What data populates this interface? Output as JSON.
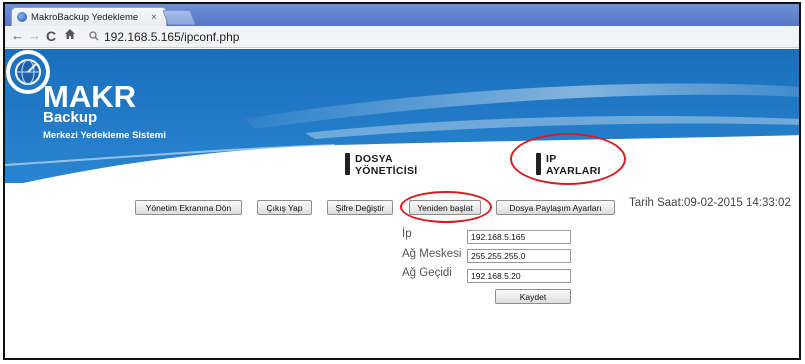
{
  "browser": {
    "tab_title": "MakroBackup Yedekleme",
    "tab_close": "×",
    "url": "192.168.5.165/ipconf.php"
  },
  "header": {
    "logo_main": "MAKR",
    "logo_sub": "Backup",
    "tagline": "Merkezi Yedekleme Sistemi"
  },
  "nav": {
    "file_manager": [
      "DOSYA",
      "YÖNETİCİSİ"
    ],
    "ip_settings": [
      "IP",
      "AYARLARI"
    ]
  },
  "actions": {
    "back_to_admin": "Yönetim Ekranına Dön",
    "logout": "Çıkış Yap",
    "change_password": "Şifre Değiştir",
    "restart": "Yeniden başlat",
    "file_sharing_settings": "Dosya Paylaşım Ayarları"
  },
  "datetime": "Tarih Saat:09-02-2015 14:33:02",
  "form": {
    "ip_label": "İp",
    "ip_value": "192.168.5.165",
    "mask_label": "Ağ Meskesi",
    "mask_value": "255.255.255.0",
    "gateway_label": "Ağ Geçidi",
    "gateway_value": "192.168.5.20",
    "save_label": "Kaydet"
  },
  "colors": {
    "banner_blue": "#1e78c4",
    "annotation_red": "#d41f24"
  }
}
